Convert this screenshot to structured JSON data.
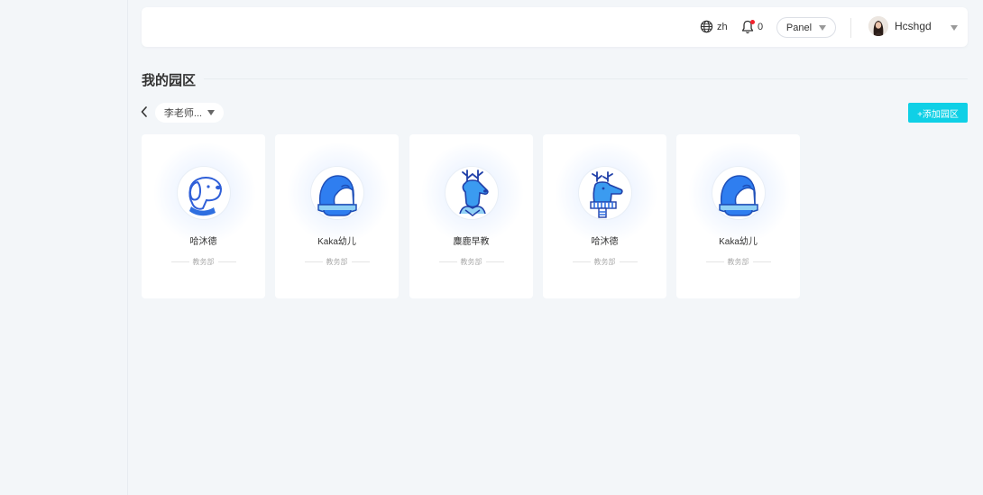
{
  "header": {
    "language": "zh",
    "notification_count": "0",
    "panel_label": "Panel",
    "username": "Hcshgd"
  },
  "page": {
    "title": "我的园区",
    "teacher_select": "李老师...",
    "add_button": "+添加园区"
  },
  "campuses": [
    {
      "name": "哈沐德",
      "dept": "教务部",
      "icon": "dog-icon"
    },
    {
      "name": "Kaka幼儿",
      "dept": "教务部",
      "icon": "penguin-icon"
    },
    {
      "name": "麋鹿早教",
      "dept": "教务部",
      "icon": "deer-icon"
    },
    {
      "name": "哈沐德",
      "dept": "教务部",
      "icon": "deer-scarf-icon"
    },
    {
      "name": "Kaka幼儿",
      "dept": "教务部",
      "icon": "penguin-icon"
    }
  ],
  "colors": {
    "accent": "#0fd0e6",
    "brand_blue": "#2f6fe0",
    "notification_dot": "#f5222d",
    "background": "#f3f6f9"
  }
}
